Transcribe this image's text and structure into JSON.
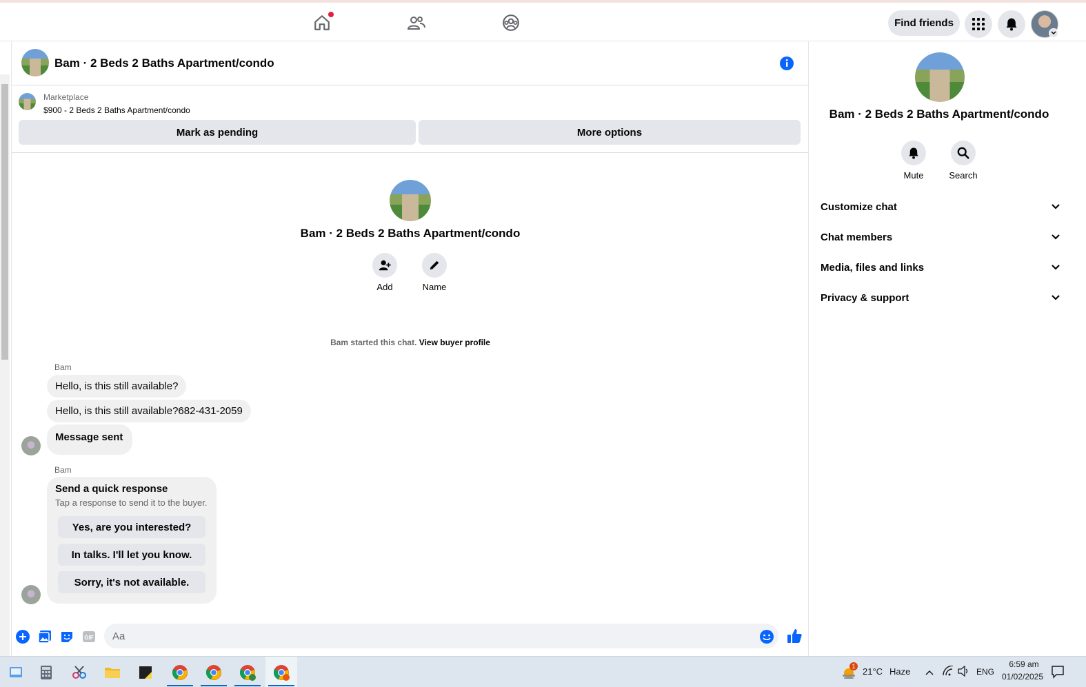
{
  "topbar": {
    "nav": [
      "home-icon",
      "friends-icon",
      "groups-icon"
    ],
    "find_friends": "Find friends",
    "menu_icon": "grid-menu-icon",
    "notifications_icon": "bell-icon"
  },
  "chat": {
    "title": "Bam · 2 Beds 2 Baths Apartment/condo",
    "marketplace_label": "Marketplace",
    "listing_price_title": "$900 - 2 Beds 2 Baths Apartment/condo",
    "mark_pending": "Mark as pending",
    "more_options": "More options",
    "intro_title": "Bam · 2 Beds 2 Baths Apartment/condo",
    "add_label": "Add",
    "name_label": "Name",
    "started_text": "Bam started this chat.",
    "view_buyer": "View buyer profile",
    "messages": [
      {
        "sender": "Bam"
      },
      {
        "text": "Hello, is this still available?"
      },
      {
        "text": "Hello, is this still available?682-431-2059"
      },
      {
        "text": "Message sent"
      }
    ],
    "quick_sender": "Bam",
    "quick_title": "Send a quick response",
    "quick_subtitle": "Tap a response to send it to the buyer.",
    "quick_options": [
      "Yes, are you interested?",
      "In talks. I'll let you know.",
      "Sorry, it's not available."
    ],
    "composer_placeholder": "Aa"
  },
  "side": {
    "title": "Bam · 2 Beds 2 Baths Apartment/condo",
    "mute": "Mute",
    "search": "Search",
    "sections": [
      "Customize chat",
      "Chat members",
      "Media, files and links",
      "Privacy & support"
    ]
  },
  "taskbar": {
    "weather_temp": "21°C",
    "weather_desc": "Haze",
    "weather_badge": "1",
    "language": "ENG",
    "time": "6:59 am",
    "date": "01/02/2025"
  },
  "colors": {
    "accent": "#0866ff",
    "bubble": "#f0f0f0",
    "button": "#e4e6eb",
    "notification": "#e41e3f"
  }
}
